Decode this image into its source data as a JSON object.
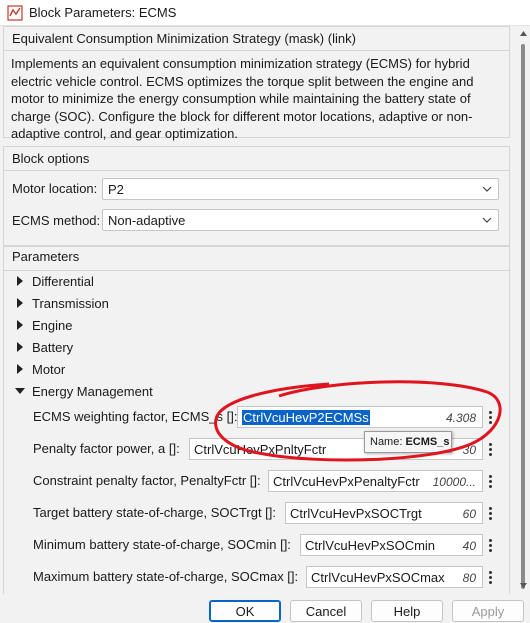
{
  "window": {
    "title": "Block Parameters: ECMS",
    "icon": "simulink-block-icon"
  },
  "description": {
    "title": "Equivalent Consumption Minimization Strategy (mask) (link)",
    "lines": [
      "Implements an equivalent consumption minimization strategy (ECMS) for hybrid",
      "electric vehicle control. ECMS optimizes the torque split between the engine and",
      "motor to minimize the energy consumption while maintaining the battery state of",
      "charge (SOC). Configure the block for different motor locations, adaptive or non-",
      "adaptive control, and gear optimization."
    ]
  },
  "block_options": {
    "title": "Block options",
    "motor_location_label": "Motor location:",
    "motor_location_value": "P2",
    "ecms_method_label": "ECMS method:",
    "ecms_method_value": "Non-adaptive"
  },
  "parameters": {
    "title": "Parameters",
    "tree": [
      {
        "label": "Differential",
        "expanded": false
      },
      {
        "label": "Transmission",
        "expanded": false
      },
      {
        "label": "Engine",
        "expanded": false
      },
      {
        "label": "Battery",
        "expanded": false
      },
      {
        "label": "Motor",
        "expanded": false
      },
      {
        "label": "Energy Management",
        "expanded": true
      }
    ],
    "fields": [
      {
        "label": "ECMS weighting factor, ECMS_s []:",
        "value": "CtrlVcuHevP2ECMSs",
        "number": "4.308"
      },
      {
        "label": "Penalty factor power, a []:",
        "value": "CtrlVcuHevPxPnltyFctr",
        "number": "30"
      },
      {
        "label": "Constraint penalty factor, PenaltyFctr []:",
        "value": "CtrlVcuHevPxPenaltyFctr",
        "number": "10000..."
      },
      {
        "label": "Target battery state-of-charge, SOCTrgt []:",
        "value": "CtrlVcuHevPxSOCTrgt",
        "number": "60"
      },
      {
        "label": "Minimum battery state-of-charge, SOCmin []:",
        "value": "CtrlVcuHevPxSOCmin",
        "number": "40"
      },
      {
        "label": "Maximum battery state-of-charge, SOCmax []:",
        "value": "CtrlVcuHevPxSOCmax",
        "number": "80"
      }
    ]
  },
  "tooltip": {
    "prefix": "Name: ",
    "name": "ECMS_s"
  },
  "buttons": {
    "ok": "OK",
    "cancel": "Cancel",
    "help": "Help",
    "apply": "Apply"
  },
  "colors": {
    "selection": "#0a64c8",
    "annotation_circle": "#e0141e",
    "ok_border": "#0a64c8"
  }
}
